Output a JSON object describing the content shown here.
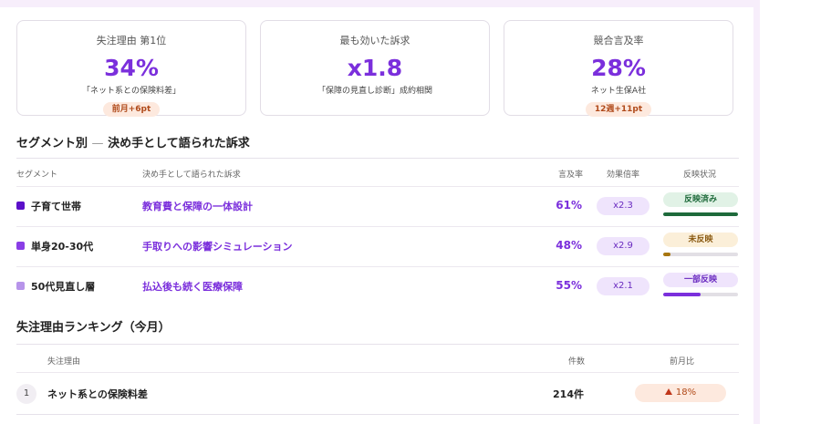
{
  "kpis": [
    {
      "label": "失注理由 第1位",
      "value": "34%",
      "sub": "「ネット系との保険料差」",
      "badge": "前月+6pt"
    },
    {
      "label": "最も効いた訴求",
      "value": "x1.8",
      "sub": "「保障の見直し診断」成約相関",
      "badge": ""
    },
    {
      "label": "競合言及率",
      "value": "28%",
      "sub": "ネット生保A社",
      "badge": "12週+11pt"
    }
  ],
  "segment_section": {
    "title": "セグメント別",
    "title_sep": "—",
    "title_rest": "決め手として語られた訴求",
    "headers": {
      "segment": "セグメント",
      "appeal": "決め手として語られた訴求",
      "rate": "言及率",
      "multiplier": "効果倍率",
      "status": "反映状況"
    },
    "rows": [
      {
        "color": "#5b10c9",
        "name": "子育て世帯",
        "appeal": "教育費と保障の一体設計",
        "rate": "61%",
        "multiplier": "x2.3",
        "status": "反映済み",
        "status_bg": "#e1f2e6",
        "status_fg": "#1e6a3b",
        "progress": 1.0,
        "bar_color": "#1e6a3b"
      },
      {
        "color": "#8a3ee6",
        "name": "単身20-30代",
        "appeal": "手取りへの影響シミュレーション",
        "rate": "48%",
        "multiplier": "x2.9",
        "status": "未反映",
        "status_bg": "#fbefd9",
        "status_fg": "#8a5a12",
        "progress": 0.1,
        "bar_color": "#a8760f"
      },
      {
        "color": "#b794ea",
        "name": "50代見直し層",
        "appeal": "払込後も続く医療保障",
        "rate": "55%",
        "multiplier": "x2.1",
        "status": "一部反映",
        "status_bg": "#efe4fc",
        "status_fg": "#6a2bc0",
        "progress": 0.5,
        "bar_color": "#7b2fdc"
      }
    ]
  },
  "ranking_section": {
    "title": "失注理由ランキング（今月）",
    "headers": {
      "reason": "失注理由",
      "count": "件数",
      "mom": "前月比"
    },
    "rows": [
      {
        "rank": "1",
        "reason": "ネット系との保険料差",
        "count": "214件",
        "delta": "18%",
        "trend": "up"
      }
    ]
  }
}
